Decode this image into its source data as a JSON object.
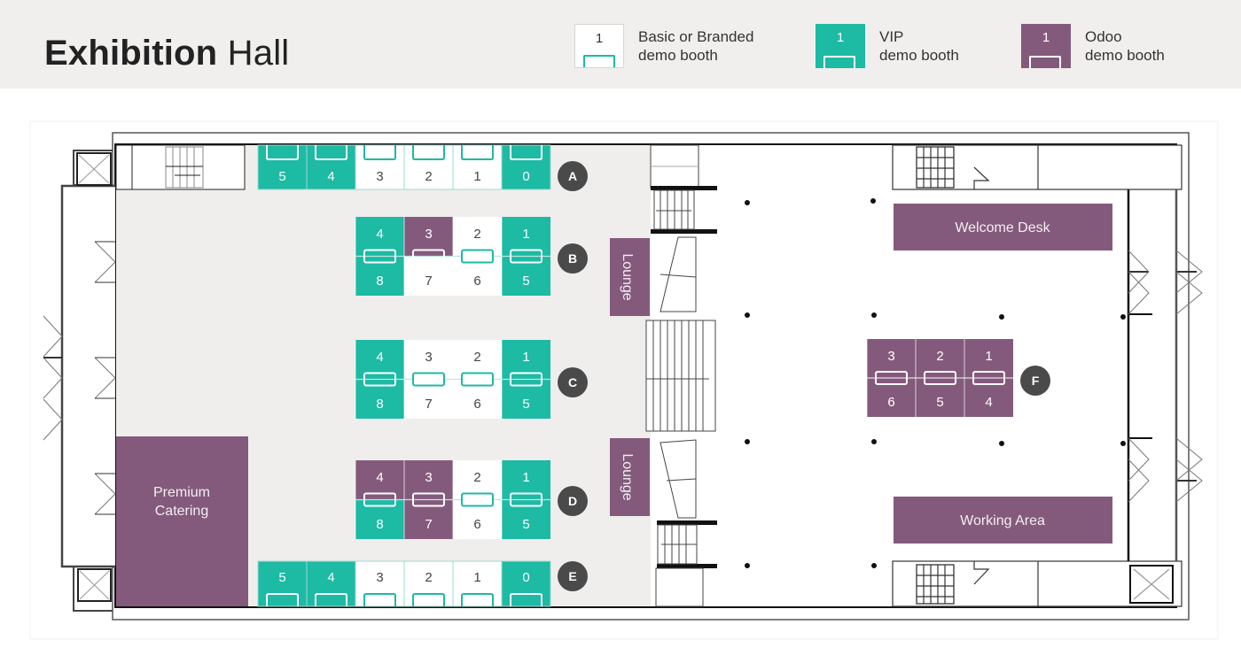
{
  "header": {
    "title_bold": "Exhibition",
    "title_light": "Hall"
  },
  "legend": [
    {
      "number": "1",
      "line1": "Basic or Branded",
      "line2": "demo booth",
      "type": "basic"
    },
    {
      "number": "1",
      "line1": "VIP",
      "line2": "demo booth",
      "type": "vip"
    },
    {
      "number": "1",
      "line1": "Odoo",
      "line2": "demo booth",
      "type": "odoo"
    }
  ],
  "colors": {
    "vip": "#1dbaa4",
    "odoo": "#845a7c",
    "basic": "#ffffff",
    "hall_floor": "#efeeec",
    "row_badge": "#4a4a4a",
    "header_bg": "#f0efed"
  },
  "rows": [
    {
      "label": "A",
      "layout": "single-top",
      "booths": [
        {
          "number": "5",
          "type": "vip"
        },
        {
          "number": "4",
          "type": "vip"
        },
        {
          "number": "3",
          "type": "basic"
        },
        {
          "number": "2",
          "type": "basic"
        },
        {
          "number": "1",
          "type": "basic"
        },
        {
          "number": "0",
          "type": "vip"
        }
      ]
    },
    {
      "label": "B",
      "layout": "double",
      "top": [
        {
          "number": "4",
          "type": "vip"
        },
        {
          "number": "3",
          "type": "odoo"
        },
        {
          "number": "2",
          "type": "basic"
        },
        {
          "number": "1",
          "type": "vip"
        }
      ],
      "bottom": [
        {
          "number": "8",
          "type": "vip"
        },
        {
          "number": "7",
          "type": "basic"
        },
        {
          "number": "6",
          "type": "basic"
        },
        {
          "number": "5",
          "type": "vip"
        }
      ]
    },
    {
      "label": "C",
      "layout": "double",
      "top": [
        {
          "number": "4",
          "type": "vip"
        },
        {
          "number": "3",
          "type": "basic"
        },
        {
          "number": "2",
          "type": "basic"
        },
        {
          "number": "1",
          "type": "vip"
        }
      ],
      "bottom": [
        {
          "number": "8",
          "type": "vip"
        },
        {
          "number": "7",
          "type": "basic"
        },
        {
          "number": "6",
          "type": "basic"
        },
        {
          "number": "5",
          "type": "vip"
        }
      ]
    },
    {
      "label": "D",
      "layout": "double",
      "top": [
        {
          "number": "4",
          "type": "odoo"
        },
        {
          "number": "3",
          "type": "odoo"
        },
        {
          "number": "2",
          "type": "basic"
        },
        {
          "number": "1",
          "type": "vip"
        }
      ],
      "bottom": [
        {
          "number": "8",
          "type": "vip"
        },
        {
          "number": "7",
          "type": "odoo"
        },
        {
          "number": "6",
          "type": "basic"
        },
        {
          "number": "5",
          "type": "vip"
        }
      ]
    },
    {
      "label": "E",
      "layout": "single-bottom",
      "booths": [
        {
          "number": "5",
          "type": "vip"
        },
        {
          "number": "4",
          "type": "vip"
        },
        {
          "number": "3",
          "type": "basic"
        },
        {
          "number": "2",
          "type": "basic"
        },
        {
          "number": "1",
          "type": "basic"
        },
        {
          "number": "0",
          "type": "vip"
        }
      ]
    },
    {
      "label": "F",
      "layout": "double",
      "top": [
        {
          "number": "3",
          "type": "odoo"
        },
        {
          "number": "2",
          "type": "odoo"
        },
        {
          "number": "1",
          "type": "odoo"
        }
      ],
      "bottom": [
        {
          "number": "6",
          "type": "odoo"
        },
        {
          "number": "5",
          "type": "odoo"
        },
        {
          "number": "4",
          "type": "odoo"
        }
      ]
    }
  ],
  "areas": {
    "premium_catering": [
      "Premium",
      "Catering"
    ],
    "lounge_top": "Lounge",
    "lounge_bottom": "Lounge",
    "welcome_desk": "Welcome Desk",
    "working_area": "Working Area"
  }
}
